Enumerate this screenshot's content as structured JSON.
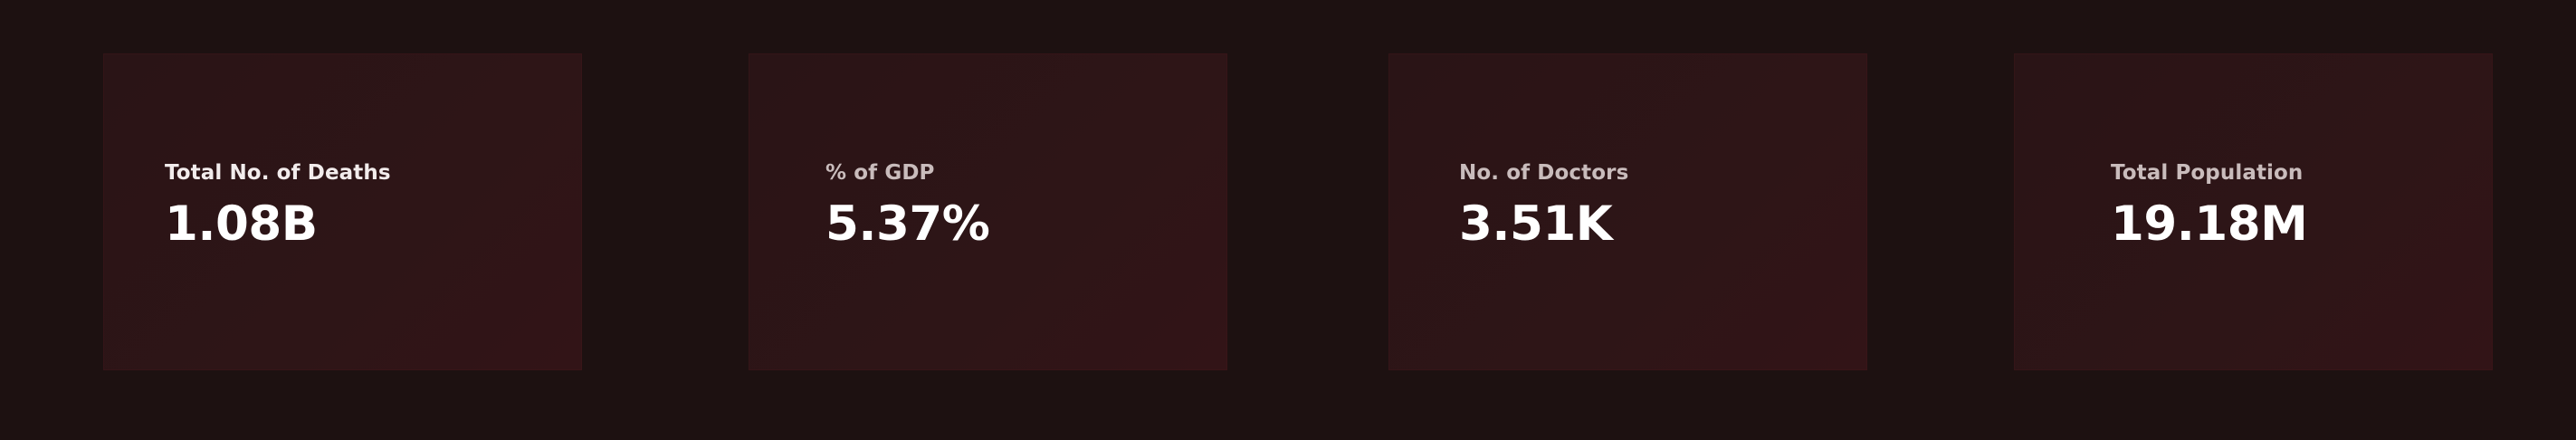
{
  "kpis": [
    {
      "label": "Total No. of Deaths",
      "value": "1.08B"
    },
    {
      "label": "% of GDP",
      "value": "5.37%"
    },
    {
      "label": "No. of Doctors",
      "value": "3.51K"
    },
    {
      "label": "Total Population",
      "value": "19.18M"
    }
  ],
  "colors": {
    "background": "#1d1111",
    "card": "#2e1517",
    "value_text": "#ffffff",
    "label_text": "#c9bcbc"
  }
}
